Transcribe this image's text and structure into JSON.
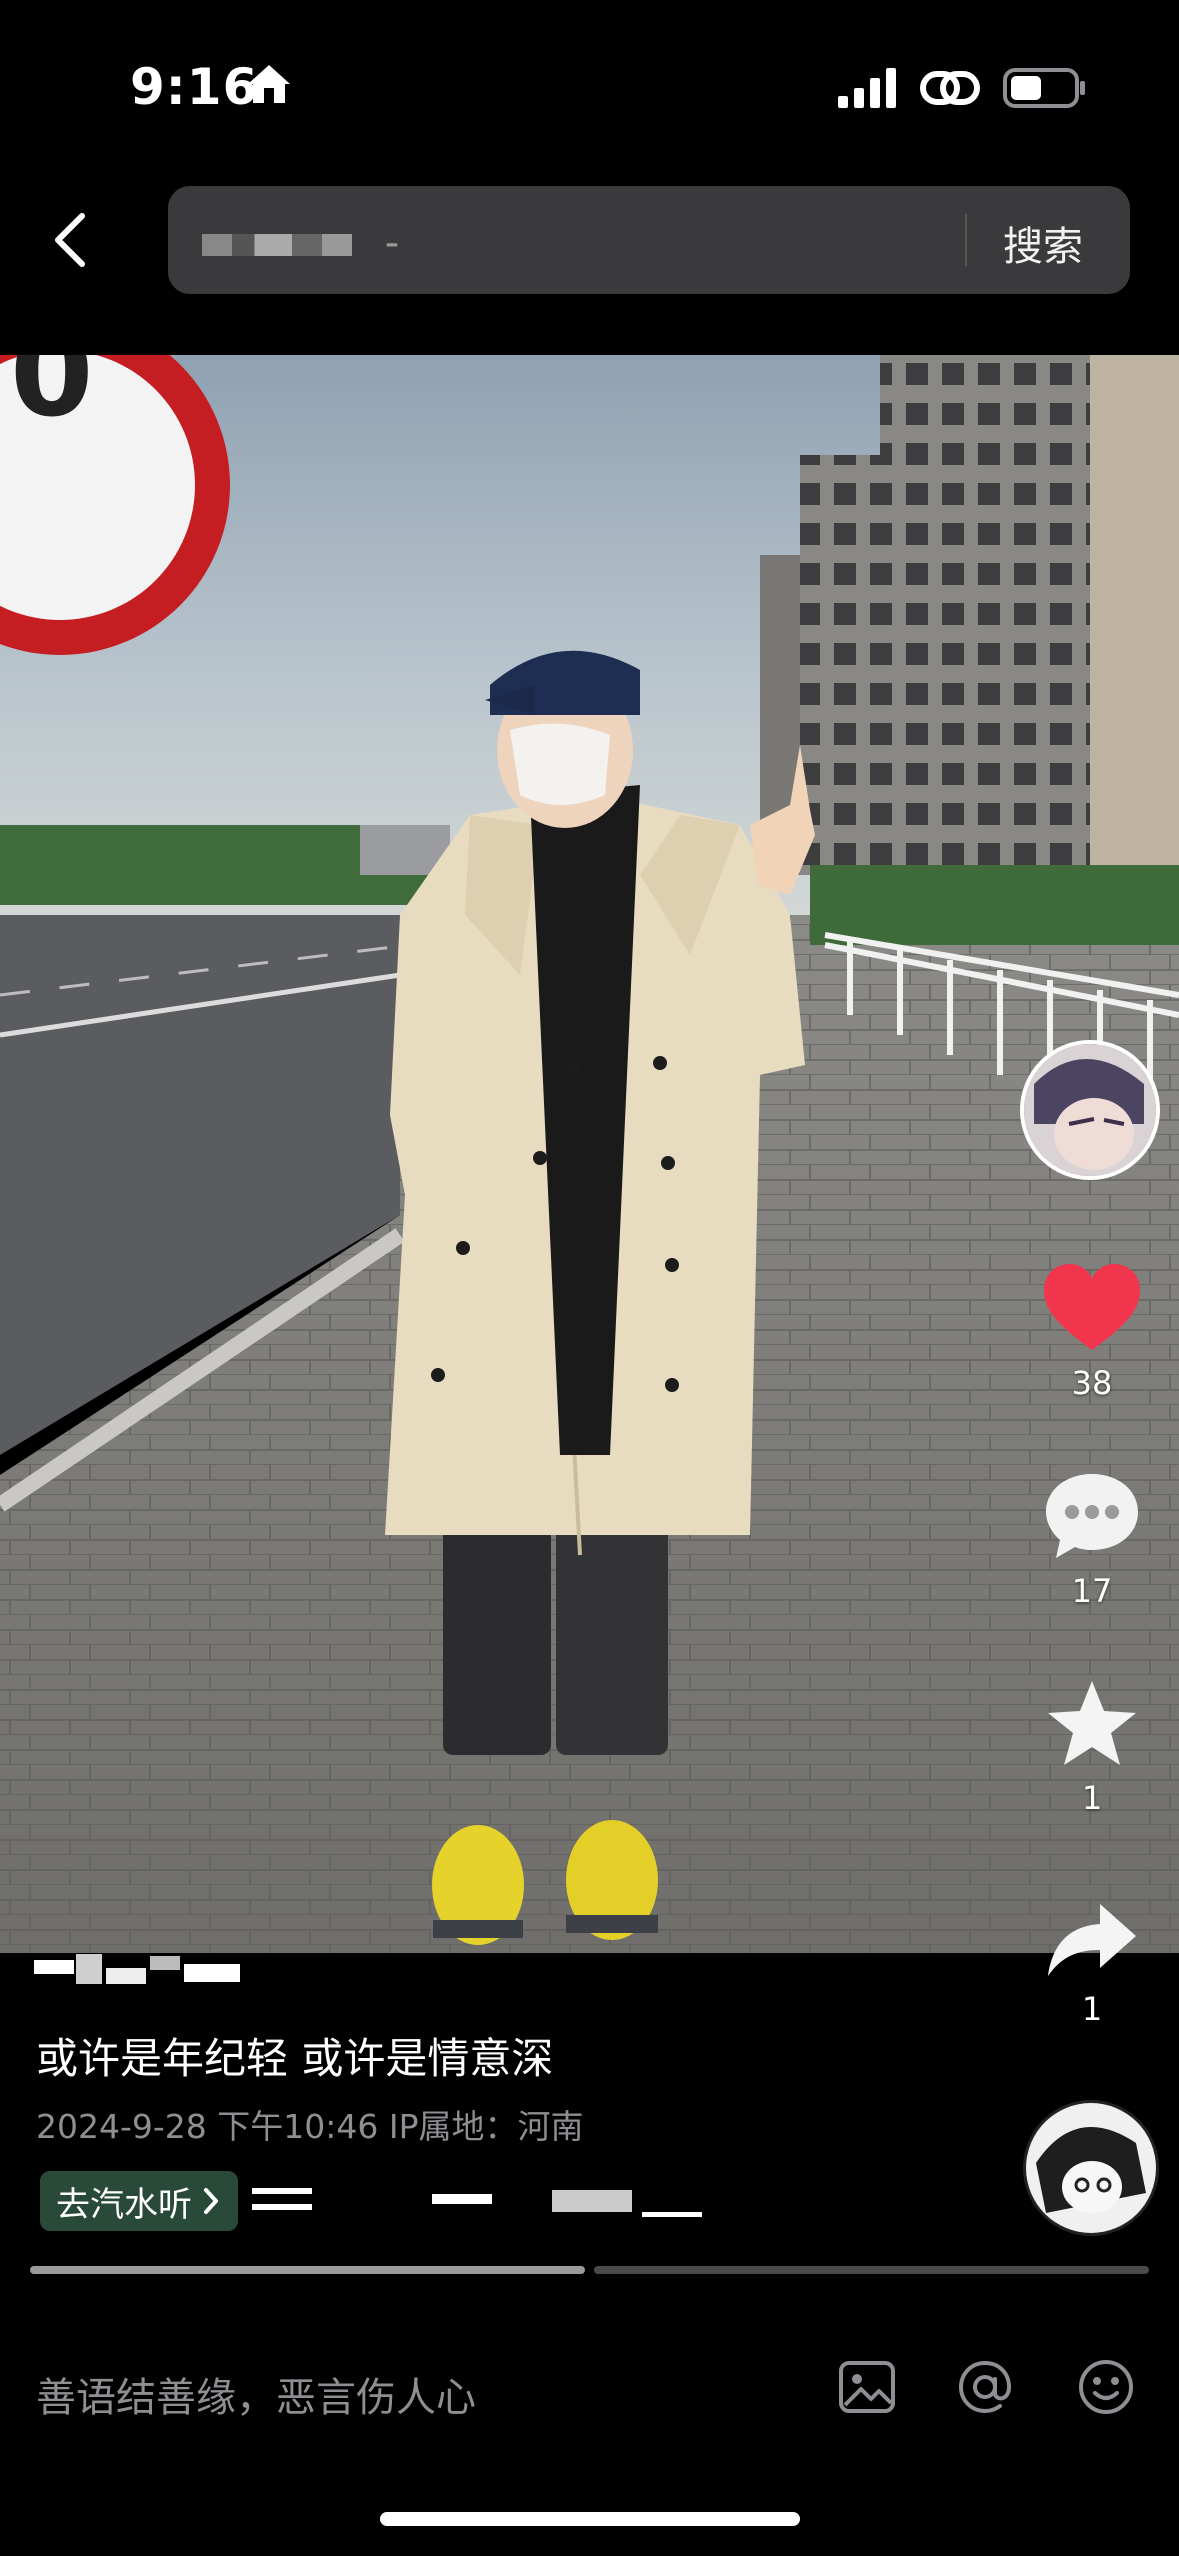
{
  "status_bar": {
    "time": "9:16",
    "icons": [
      "home-icon",
      "signal-icon",
      "link-icon",
      "battery-icon"
    ]
  },
  "search": {
    "query": "-",
    "button_label": "搜索"
  },
  "post": {
    "caption": "或许是年纪轻 或许是情意深",
    "meta": "2024-9-28 下午10:46  IP属地：河南",
    "music_chip": "去汽水听",
    "progress": {
      "segments": 2,
      "current": 1
    }
  },
  "actions": {
    "likes": "38",
    "comments": "17",
    "favorites": "1",
    "shares": "1"
  },
  "comment_bar": {
    "placeholder": "善语结善缘，恶言伤人心"
  },
  "colors": {
    "like": "#f0354d",
    "chip_bg": "#294a39",
    "search_bg": "#3a3a3c"
  }
}
